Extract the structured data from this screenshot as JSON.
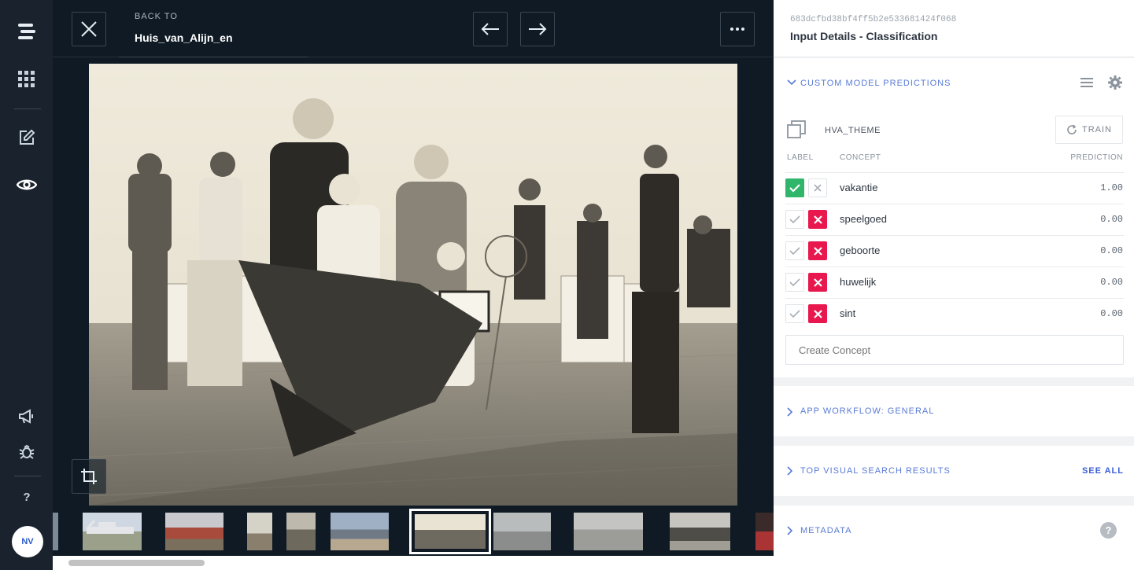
{
  "viewer": {
    "back_label": "BACK TO",
    "back_name": "Huis_van_Alijn_en",
    "icons": {
      "close": "close-icon",
      "prev": "arrow-left-icon",
      "next": "arrow-right-icon",
      "more": "more-horizontal-icon",
      "crop": "crop-icon"
    }
  },
  "rail": {
    "avatar_initials": "NV",
    "help_label": "?"
  },
  "panel": {
    "input_id": "683dcfbd38bf4ff5b2e533681424f068",
    "title": "Input Details - Classification",
    "custom_section": {
      "title": "CUSTOM MODEL PREDICTIONS",
      "model_name": "HVA_THEME",
      "train_label": "TRAIN",
      "columns": {
        "label": "LABEL",
        "concept": "CONCEPT",
        "prediction": "PREDICTION"
      },
      "rows": [
        {
          "concept": "vakantie",
          "prediction": "1.00",
          "state": "positive"
        },
        {
          "concept": "speelgoed",
          "prediction": "0.00",
          "state": "negative"
        },
        {
          "concept": "geboorte",
          "prediction": "0.00",
          "state": "negative"
        },
        {
          "concept": "huwelijk",
          "prediction": "0.00",
          "state": "negative"
        },
        {
          "concept": "sint",
          "prediction": "0.00",
          "state": "negative"
        }
      ],
      "create_placeholder": "Create Concept"
    },
    "workflow_section": {
      "title": "APP WORKFLOW: GENERAL"
    },
    "visual_search_section": {
      "title": "TOP VISUAL SEARCH RESULTS",
      "see_all": "SEE ALL"
    },
    "metadata_section": {
      "title": "METADATA",
      "help": "?"
    }
  },
  "colors": {
    "accent": "#5a7bd6",
    "positive": "#2fb66b",
    "negative": "#e8174d",
    "dark_bg": "#0f1a24"
  }
}
